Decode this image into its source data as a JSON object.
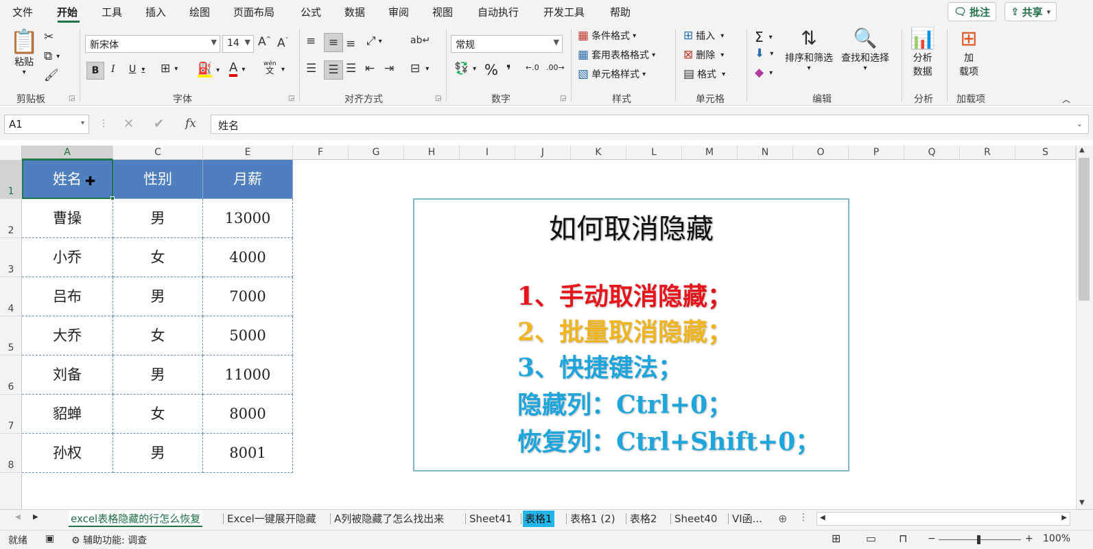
{
  "menu": {
    "items": [
      "文件",
      "开始",
      "工具",
      "插入",
      "绘图",
      "页面布局",
      "公式",
      "数据",
      "审阅",
      "视图",
      "自动执行",
      "开发工具",
      "帮助"
    ],
    "active": "开始",
    "comment_btn": "批注",
    "share_btn": "共享"
  },
  "ribbon": {
    "groups": [
      "剪贴板",
      "字体",
      "对齐方式",
      "数字",
      "样式",
      "单元格",
      "编辑",
      "分析",
      "加载项"
    ],
    "paste": "粘贴",
    "font_name": "新宋体",
    "font_size": "14",
    "number_format": "常规",
    "conditional_format": "条件格式",
    "table_format": "套用表格格式",
    "cell_style": "单元格样式",
    "insert": "插入",
    "delete": "删除",
    "format": "格式",
    "sort_filter": "排序和筛选",
    "find_select": "查找和选择",
    "analyze_data_1": "分析",
    "analyze_data_2": "数据",
    "addins_1": "加",
    "addins_2": "载项",
    "wen": "wén",
    "wen_sub": "文"
  },
  "formula_bar": {
    "name_box": "A1",
    "formula": "姓名"
  },
  "columns": [
    "A",
    "C",
    "E",
    "F",
    "G",
    "H",
    "I",
    "J",
    "K",
    "L",
    "M",
    "N",
    "O",
    "P",
    "Q",
    "R",
    "S"
  ],
  "rows": [
    "1",
    "2",
    "3",
    "4",
    "5",
    "6",
    "7",
    "8"
  ],
  "table": {
    "headers": [
      "姓名",
      "性别",
      "月薪"
    ],
    "rows": [
      [
        "曹操",
        "男",
        "13000"
      ],
      [
        "小乔",
        "女",
        "4000"
      ],
      [
        "吕布",
        "男",
        "7000"
      ],
      [
        "大乔",
        "女",
        "5000"
      ],
      [
        "刘备",
        "男",
        "11000"
      ],
      [
        "貂蝉",
        "女",
        "8000"
      ],
      [
        "孙权",
        "男",
        "8001"
      ]
    ]
  },
  "textbox": {
    "title": "如何取消隐藏",
    "line1": "1、手动取消隐藏；",
    "line2": "2、批量取消隐藏；",
    "line3": "3、快捷键法；",
    "line4": "隐藏列：Ctrl+0；",
    "line5": "恢复列：Ctrl+Shift+0；",
    "color1": "#e8141c",
    "color2": "#f0b41e",
    "color3": "#1ea6dc"
  },
  "sheet_tabs": [
    "excel表格隐藏的行怎么恢复",
    "Excel一键展开隐藏",
    "A列被隐藏了怎么找出来",
    "Sheet41",
    "表格1",
    "表格1 (2)",
    "表格2",
    "Sheet40",
    "VI函..."
  ],
  "status": {
    "ready": "就绪",
    "accessibility": "辅助功能: 调查",
    "zoom": "100%"
  }
}
